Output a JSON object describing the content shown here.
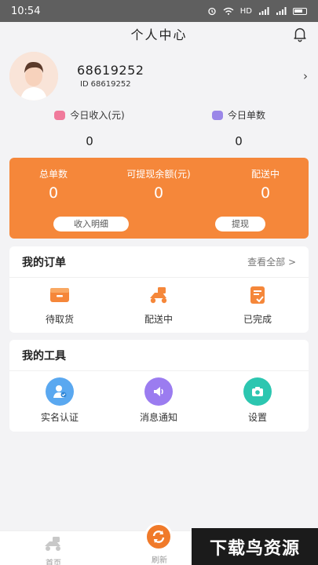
{
  "statusbar": {
    "time": "10:54",
    "network": "HD"
  },
  "nav": {
    "title": "个人中心"
  },
  "profile": {
    "name": "68619252",
    "id_prefix": "ID",
    "id": "68619252"
  },
  "today": {
    "income_label": "今日收入(元)",
    "income_value": "0",
    "orders_label": "今日单数",
    "orders_value": "0"
  },
  "summary": {
    "total_label": "总单数",
    "total_value": "0",
    "withdrawable_label": "可提现余额(元)",
    "withdrawable_value": "0",
    "delivering_label": "配送中",
    "delivering_value": "0",
    "income_detail_button": "收入明细",
    "withdraw_button": "提现"
  },
  "orders": {
    "title": "我的订单",
    "view_all": "查看全部 >",
    "items": [
      {
        "label": "待取货",
        "icon": "box-icon"
      },
      {
        "label": "配送中",
        "icon": "scooter-icon"
      },
      {
        "label": "已完成",
        "icon": "completed-icon"
      }
    ]
  },
  "tools": {
    "title": "我的工具",
    "items": [
      {
        "label": "实名认证",
        "icon": "user-verify-icon",
        "color": "#5aa8f0"
      },
      {
        "label": "消息通知",
        "icon": "speaker-icon",
        "color": "#9b7cf0"
      },
      {
        "label": "设置",
        "icon": "camera-settings-icon",
        "color": "#2cc6b0"
      }
    ]
  },
  "tabbar": {
    "home": "首页",
    "refresh": "刷新"
  },
  "watermark": "下载鸟资源",
  "colors": {
    "accent": "#f5873a",
    "background": "#f3f3f5"
  }
}
